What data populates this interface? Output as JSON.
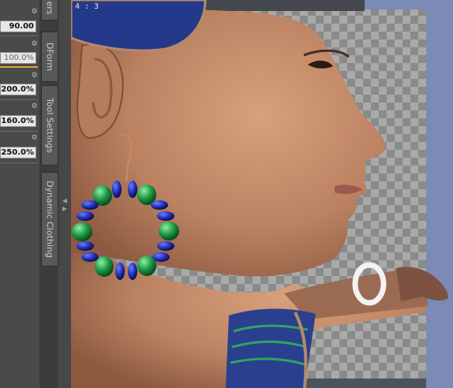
{
  "params": [
    {
      "value": "90.00",
      "style": "normal"
    },
    {
      "value": "100.0%",
      "style": "muted"
    },
    {
      "value": "200.0%",
      "style": "normal"
    },
    {
      "value": "160.0%",
      "style": "normal"
    },
    {
      "value": "250.0%",
      "style": "normal"
    }
  ],
  "tabs": {
    "top_partial": "ers",
    "dform": "DForm",
    "tool_settings": "Tool Settings",
    "dynamic_clothing": "Dynamic Clothing"
  },
  "viewport": {
    "aspect_label": "4 : 3"
  },
  "colors": {
    "panel_bg": "#4a4a4a",
    "slider_accent": "#d9a83a",
    "viewport_bg": "#7b8bb5",
    "skin": "#c78e6d",
    "bead_blue": "#1f2fb5",
    "bead_green": "#1f9a45"
  },
  "icons": {
    "param_menu": "gear-icon",
    "splitter": "grip-icon"
  }
}
